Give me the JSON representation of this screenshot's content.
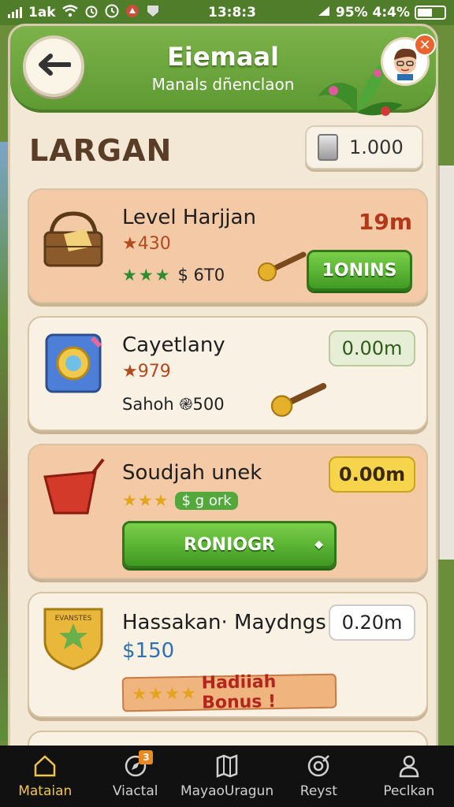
{
  "status_bar": {
    "carrier": "1ak",
    "time": "13:8:3",
    "battery": "95% 4:4%"
  },
  "header": {
    "title": "Eiemaal",
    "subtitle": "Manals dñenclaon"
  },
  "section": {
    "title": "LARGAN",
    "currency_value": "1.000"
  },
  "cards": [
    {
      "title": "Level Harjjan",
      "stars_value": "★430",
      "sub_text": "$ 6T0",
      "time": "19m",
      "button_label": "1ONINS"
    },
    {
      "title": "Cayetlany",
      "stars_value": "★979",
      "sub_text": "Sahoh ֎500",
      "time": "0.00m"
    },
    {
      "title": "Soudjah unek",
      "badge": "g ork",
      "time": "0.00m",
      "button_label": "RONIOGR"
    },
    {
      "title": "Hassakan· Maydngs",
      "price": "$150",
      "time": "0.20m",
      "bonus": "Hadiiah Bonus !",
      "shield_label": "EVANSTES"
    }
  ],
  "nav": [
    {
      "label": "Mataian",
      "icon": "home-icon"
    },
    {
      "label": "Viactal",
      "icon": "compass-icon",
      "badge": "3"
    },
    {
      "label": "MayaoUragun",
      "icon": "map-icon"
    },
    {
      "label": "Reyst",
      "icon": "target-icon"
    },
    {
      "label": "Peclkan",
      "icon": "person-icon"
    }
  ],
  "colors": {
    "header_green": "#6aa63b",
    "panel_cream": "#f3e7d6",
    "accent_green": "#3f9a22",
    "accent_yellow": "#f6d44b",
    "nav_active": "#f0c54b"
  }
}
